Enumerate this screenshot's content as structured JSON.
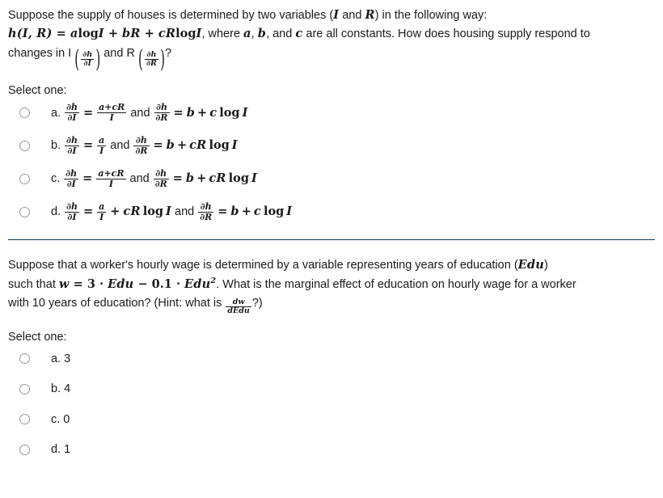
{
  "quiz": {
    "questions": [
      {
        "id": "q1",
        "stem": {
          "line1_a": "Suppose the supply of houses is determined by two variables (",
          "line1_var1": "I",
          "line1_mid": " and ",
          "line1_var2": "R",
          "line1_b": ") in the following way:",
          "line2_formula_h": "h(I, R)",
          "line2_eq": " = ",
          "line2_a": "a",
          "line2_log1": "log",
          "line2_I1": "I",
          "line2_plus1": " + ",
          "line2_bR": "bR",
          "line2_plus2": " + ",
          "line2_cR": "cR",
          "line2_log2": "log",
          "line2_I2": "I",
          "line2_rest_pre": ", where ",
          "line2_const_a": "a",
          "line2_comma1": ", ",
          "line2_const_b": "b",
          "line2_comma2": ", and ",
          "line2_const_c": "c",
          "line2_rest_post": " are all constants. How does housing supply respond to",
          "line3_pre": "changes in I ",
          "line3_frac1_num": "∂h",
          "line3_frac1_den": "∂I",
          "line3_mid": " and R ",
          "line3_frac2_num": "∂h",
          "line3_frac2_den": "∂R",
          "line3_post": "?"
        },
        "select_label": "Select one:",
        "options": [
          {
            "letter": "a.",
            "lhs_num": "∂h",
            "lhs_den": "∂I",
            "eq": "=",
            "rhs_num": "a+cR",
            "rhs_den": "I",
            "conj": "and",
            "lhs2_num": "∂h",
            "lhs2_den": "∂R",
            "eq2": "=",
            "rhs2_b": "b",
            "rhs2_plus": "+",
            "rhs2_coef": "c",
            "rhs2_log": "log",
            "rhs2_var": "I",
            "rhs_style": "fraction"
          },
          {
            "letter": "b.",
            "lhs_num": "∂h",
            "lhs_den": "∂I",
            "eq": "=",
            "rhs_num": "a",
            "rhs_den": "I",
            "conj": "and",
            "lhs2_num": "∂h",
            "lhs2_den": "∂R",
            "eq2": "=",
            "rhs2_b": "b",
            "rhs2_plus": "+",
            "rhs2_coef": "cR",
            "rhs2_log": "log",
            "rhs2_var": "I",
            "rhs_style": "fraction"
          },
          {
            "letter": "c.",
            "lhs_num": "∂h",
            "lhs_den": "∂I",
            "eq": "=",
            "rhs_num": "a+cR",
            "rhs_den": "I",
            "conj": "and",
            "lhs2_num": "∂h",
            "lhs2_den": "∂R",
            "eq2": "=",
            "rhs2_b": "b",
            "rhs2_plus": "+",
            "rhs2_coef": "cR",
            "rhs2_log": "log",
            "rhs2_var": "I",
            "rhs_style": "fraction"
          },
          {
            "letter": "d.",
            "lhs_num": "∂h",
            "lhs_den": "∂I",
            "eq": "=",
            "rhs_num": "a",
            "rhs_den": "I",
            "rhs_extra_plus": "+",
            "rhs_extra_coef": "cR",
            "rhs_extra_log": "log",
            "rhs_extra_var": "I",
            "conj": "and",
            "lhs2_num": "∂h",
            "lhs2_den": "∂R",
            "eq2": "=",
            "rhs2_b": "b",
            "rhs2_plus": "+",
            "rhs2_coef": "c",
            "rhs2_log": "log",
            "rhs2_var": "I",
            "rhs_style": "fraction-plus"
          }
        ]
      },
      {
        "id": "q2",
        "stem": {
          "line1_a": "Suppose that a worker's hourly wage is determined by a variable representing years of education (",
          "line1_var": "Edu",
          "line1_b": ")",
          "line2_pre": "such that ",
          "line2_w": "w",
          "line2_eq": " = ",
          "line2_three": "3",
          "line2_dot1": " · ",
          "line2_edu1": "Edu",
          "line2_minus": " − ",
          "line2_tenth": "0.1",
          "line2_dot2": " · ",
          "line2_edu2": "Edu",
          "line2_exp": "2",
          "line2_post": ". What is the marginal effect of education on hourly wage for a worker",
          "line3_pre": "with 10 years of education? (Hint: what is ",
          "line3_frac_num": "dw",
          "line3_frac_den": "dEdu",
          "line3_post": "?)"
        },
        "select_label": "Select one:",
        "options": [
          {
            "letter": "a.",
            "value": "3"
          },
          {
            "letter": "b.",
            "value": "4"
          },
          {
            "letter": "c.",
            "value": "0"
          },
          {
            "letter": "d.",
            "value": "1"
          }
        ]
      }
    ]
  },
  "style": {
    "divider_color": "#0b3a5c",
    "text_color": "#1a1a1a",
    "radio_border": "#999999"
  }
}
